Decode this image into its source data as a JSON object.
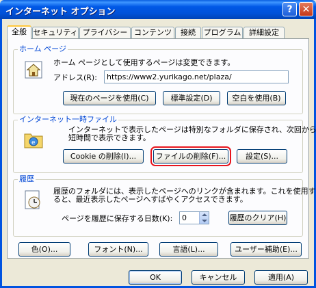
{
  "window": {
    "title": "インターネット オプション",
    "help_label": "?",
    "close_label": "✕"
  },
  "tabs": [
    {
      "label": "全般",
      "active": true
    },
    {
      "label": "セキュリティ"
    },
    {
      "label": "プライバシー"
    },
    {
      "label": "コンテンツ"
    },
    {
      "label": "接続"
    },
    {
      "label": "プログラム"
    },
    {
      "label": "詳細設定"
    }
  ],
  "home": {
    "legend": "ホーム ページ",
    "description": "ホーム ページとして使用するページは変更できます。",
    "address_label": "アドレス(R):",
    "address_value": "https://www2.yurikago.net/plaza/",
    "buttons": {
      "use_current": "現在のページを使用(C)",
      "use_default": "標準設定(D)",
      "use_blank": "空白を使用(B)"
    }
  },
  "temp": {
    "legend": "インターネット一時ファイル",
    "description_line1": "インターネットで表示したページは特別なフォルダに保存され、次回からは",
    "description_line2": "短時間で表示できます。",
    "buttons": {
      "delete_cookies": "Cookie の削除(I)...",
      "delete_files": "ファイルの削除(F)...",
      "settings": "設定(S)..."
    }
  },
  "history": {
    "legend": "履歴",
    "description_line1": "履歴のフォルダには、表示したページへのリンクが含まれます。これを使用す",
    "description_line2": "ると、最近表示したページへすばやくアクセスできます。",
    "days_label": "ページを履歴に保存する日数(K):",
    "days_value": "0",
    "clear_button": "履歴のクリア(H)"
  },
  "bottom_buttons": {
    "colors": "色(O)...",
    "fonts": "フォント(N)...",
    "languages": "言語(L)...",
    "accessibility": "ユーザー補助(E)..."
  },
  "dialog_buttons": {
    "ok": "OK",
    "cancel": "キャンセル",
    "apply": "適用(A)"
  },
  "colors": {
    "titlebar": "#0058E6",
    "highlight_outline": "#E8141C",
    "group_legend": "#0046D5"
  }
}
